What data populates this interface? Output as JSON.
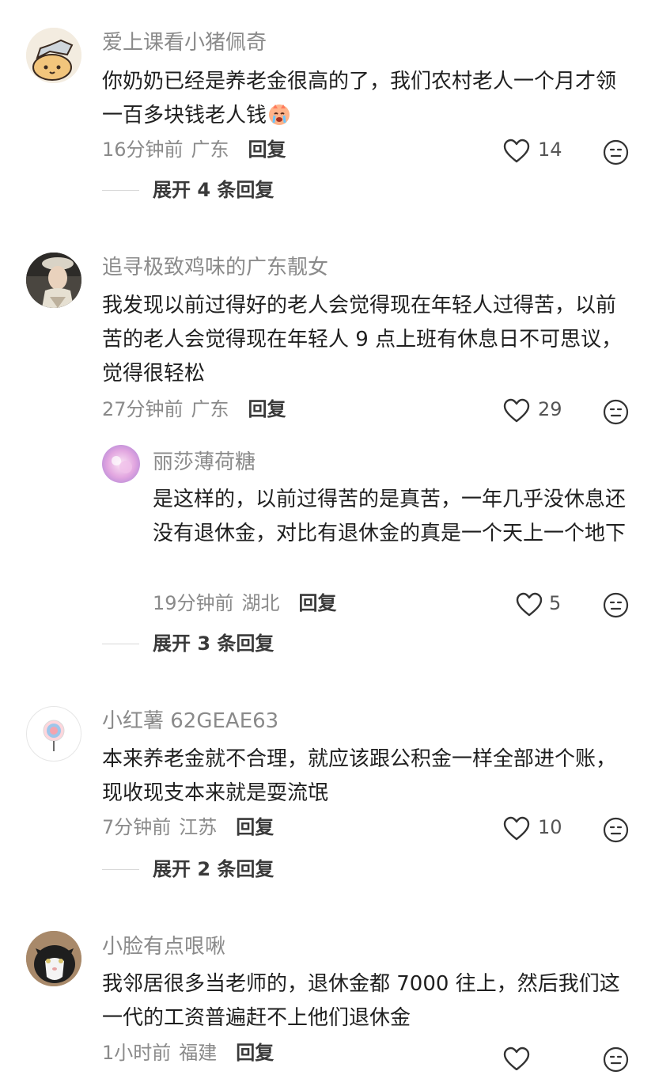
{
  "comments": [
    {
      "username": "爱上课看小猪佩奇",
      "text": "你奶奶已经是养老金很高的了，我们农村老人一个月才领一百多块钱老人钱",
      "time": "16分钟前",
      "location": "广东",
      "reply_label": "回复",
      "likes": "14",
      "expand": "展开 4 条回复"
    },
    {
      "username": "追寻极致鸡味的广东靓女",
      "text": "我发现以前过得好的老人会觉得现在年轻人过得苦，以前苦的老人会觉得现在年轻人 9 点上班有休息日不可思议，觉得很轻松",
      "time": "27分钟前",
      "location": "广东",
      "reply_label": "回复",
      "likes": "29",
      "reply": {
        "username": "丽莎薄荷糖",
        "text": "是这样的，以前过得苦的是真苦，一年几乎没休息还没有退休金，对比有退休金的真是一个天上一个地下",
        "time": "19分钟前",
        "location": "湖北",
        "reply_label": "回复",
        "likes": "5"
      },
      "expand": "展开 3 条回复"
    },
    {
      "username": "小红薯 62GEAE63",
      "text": "本来养老金就不合理，就应该跟公积金一样全部进个账，现收现支本来就是耍流氓",
      "time": "7分钟前",
      "location": "江苏",
      "reply_label": "回复",
      "likes": "10",
      "expand": "展开 2 条回复"
    },
    {
      "username": "小脸有点哏啾",
      "text": "我邻居很多当老师的，退休金都 7000 往上，然后我们这一代的工资普遍赶不上他们退休金",
      "time": "1小时前",
      "location": "福建",
      "reply_label": "回复"
    }
  ],
  "icons": {
    "like": "heart-outline-icon",
    "react": "neutral-face-icon",
    "inline_emoji": "crying-face-emoji"
  },
  "colors": {
    "username": "#8a8a8a",
    "body": "#1f1f1f",
    "meta": "#8a8a8a",
    "divider": "#d8d8d8"
  }
}
